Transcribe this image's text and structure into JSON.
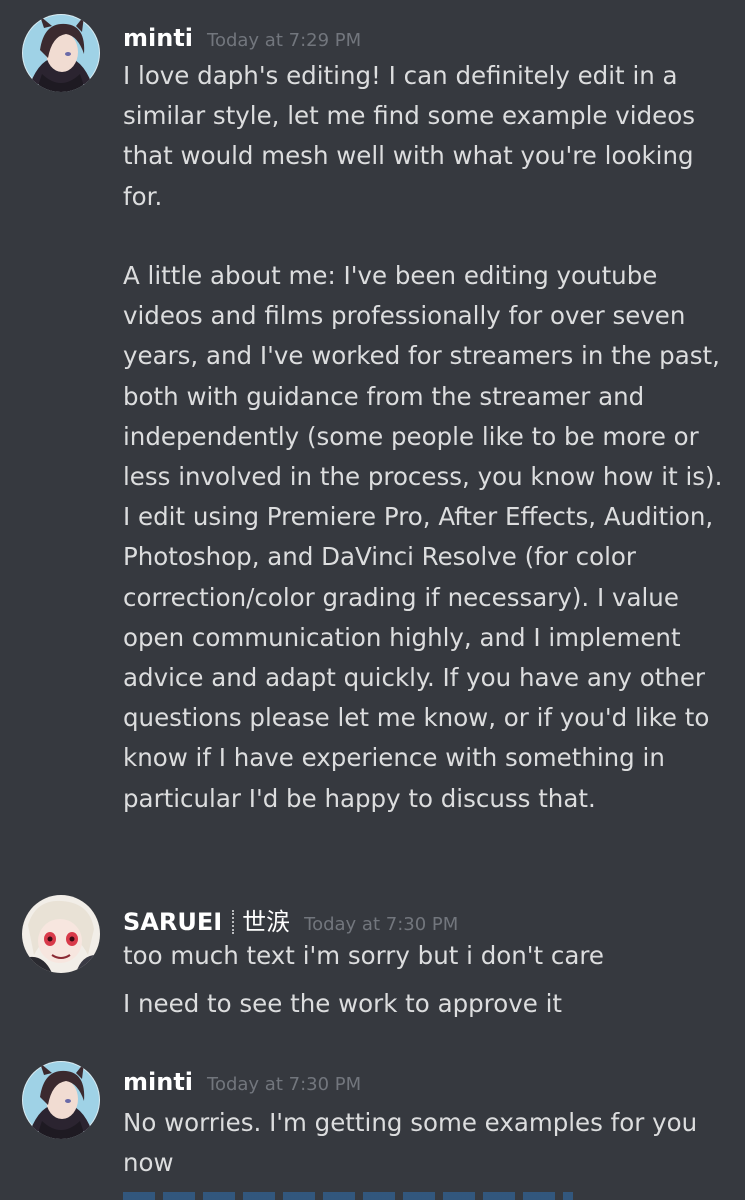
{
  "messages": [
    {
      "author": "minti",
      "timestamp": "Today at 7:29 PM",
      "paragraphs": [
        "I love daph's editing!  I can definitely edit in a similar style, let me find some example videos that would mesh well with what you're looking for.",
        "A little about me: I've been editing youtube videos and films professionally for over seven years, and I've worked for streamers in the past, both with guidance from the streamer and independently (some people like to be more or less involved in the process, you know how it is).  I edit using Premiere Pro, After Effects, Audition, Photoshop, and DaVinci Resolve (for color correction/color grading if necessary).  I value open communication highly, and I implement advice and adapt quickly.  If you have any other questions please let me know, or if you'd like to know if I have experience with something in particular I'd be happy to discuss that."
      ]
    },
    {
      "author": "SARUEI",
      "author_tag": "世涙",
      "timestamp": "Today at 7:30 PM",
      "lines": [
        "too much text i'm sorry but i don't care",
        "I need to see the work to approve it"
      ]
    },
    {
      "author": "minti",
      "timestamp": "Today at 7:30 PM",
      "lines": [
        "No worries.  I'm getting some examples for you now"
      ]
    }
  ],
  "icons": {
    "avatar_minti": "avatar-minti-icon",
    "avatar_saruei": "avatar-saruei-icon"
  },
  "colors": {
    "background": "#36393f",
    "username": "#ffffff",
    "timestamp": "#72767d",
    "message_text": "#dcddde"
  }
}
